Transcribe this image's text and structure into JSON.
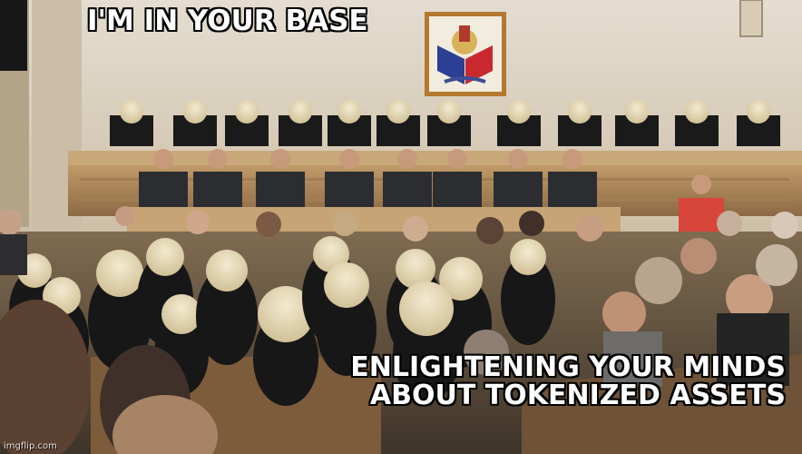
{
  "meme": {
    "top_text": "I'M IN YOUR BASE",
    "bottom_lines": [
      "ENLIGHTENING YOUR MINDS",
      "ABOUT TOKENIZED ASSETS"
    ],
    "watermark": "imgflip.com"
  },
  "colors": {
    "wall": "#ddd5c6",
    "bench_wood": "#b78d5d",
    "wig": "#e6dab8",
    "robe": "#171717",
    "caption_fill": "#ffffff",
    "caption_stroke": "#000000",
    "coat_of_arms_red": "#c9282d",
    "coat_of_arms_blue": "#2b3f94"
  },
  "icons": {
    "coat_of_arms": "coat-of-arms-icon",
    "speaker": "wall-speaker-icon"
  }
}
